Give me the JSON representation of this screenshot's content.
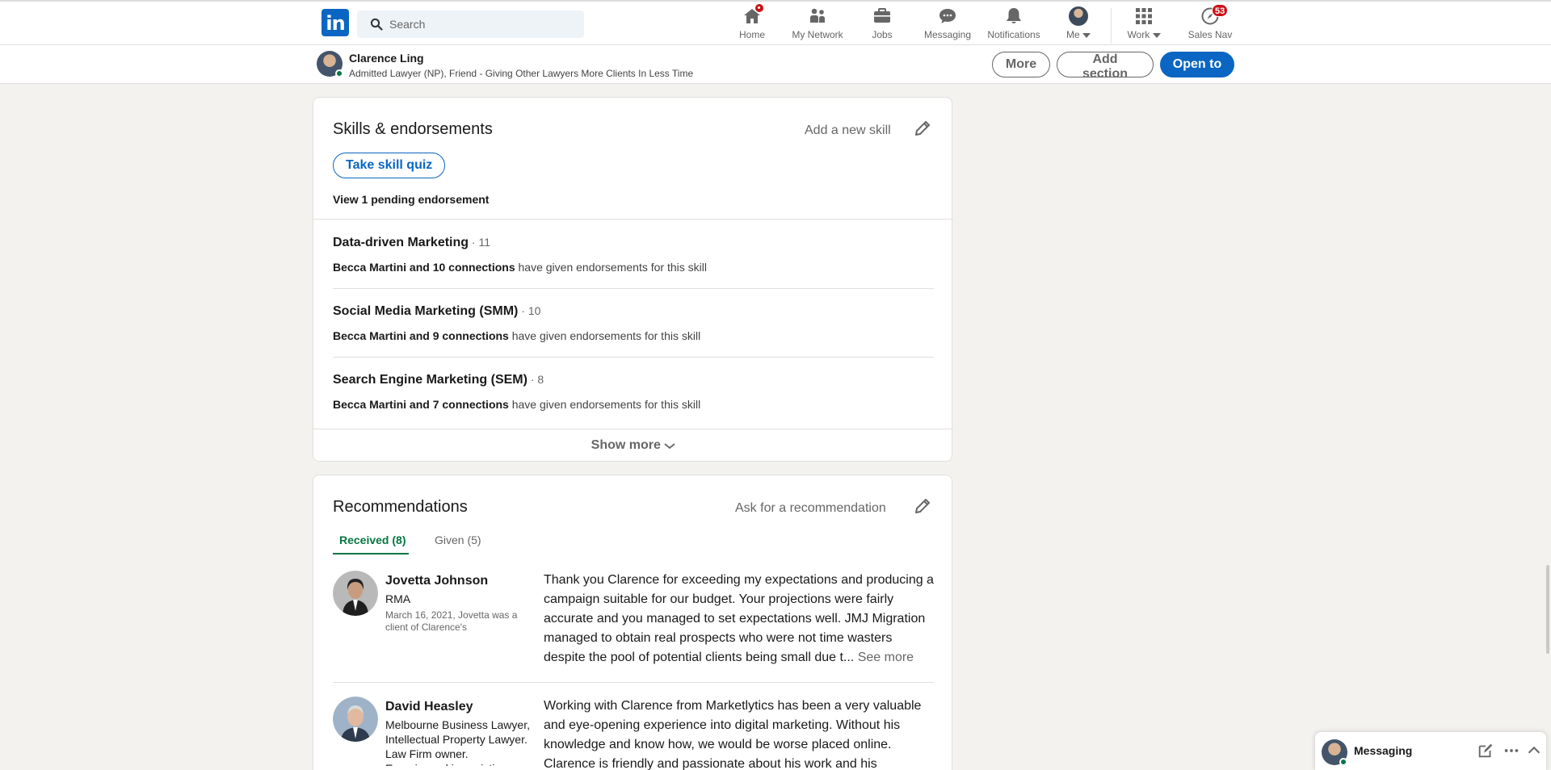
{
  "nav": {
    "logo": "in",
    "search_placeholder": "Search",
    "items": [
      {
        "label": "Home",
        "icon": "home-icon",
        "badge": ""
      },
      {
        "label": "My Network",
        "icon": "people-icon",
        "badge": ""
      },
      {
        "label": "Jobs",
        "icon": "briefcase-icon",
        "badge": ""
      },
      {
        "label": "Messaging",
        "icon": "chat-icon",
        "badge": ""
      },
      {
        "label": "Notifications",
        "icon": "bell-icon",
        "badge": ""
      },
      {
        "label": "Me",
        "icon": "avatar",
        "badge": ""
      },
      {
        "label": "Work",
        "icon": "grid-icon",
        "badge": ""
      },
      {
        "label": "Sales Nav",
        "icon": "compass-icon",
        "badge": "53"
      }
    ]
  },
  "profile_bar": {
    "name": "Clarence Ling",
    "headline": "Admitted Lawyer (NP), Friend - Giving Other Lawyers More Clients In Less Time",
    "more_label": "More",
    "add_section_label": "Add section",
    "open_to_label": "Open to"
  },
  "skills": {
    "title": "Skills & endorsements",
    "add_label": "Add a new skill",
    "quiz_label": "Take skill quiz",
    "pending_label": "View 1 pending endorsement",
    "items": [
      {
        "name": "Data-driven Marketing",
        "count": " · 11",
        "endorsers": "Becca Martini and 10 connections",
        "suffix": " have given endorsements for this skill"
      },
      {
        "name": "Social Media Marketing (SMM)",
        "count": " · 10",
        "endorsers": "Becca Martini and 9 connections",
        "suffix": " have given endorsements for this skill"
      },
      {
        "name": "Search Engine Marketing (SEM)",
        "count": " · 8",
        "endorsers": "Becca Martini and 7 connections",
        "suffix": " have given endorsements for this skill"
      }
    ],
    "show_more_label": "Show more"
  },
  "recommendations": {
    "title": "Recommendations",
    "ask_label": "Ask for a recommendation",
    "tab_received": "Received (8)",
    "tab_given": "Given (5)",
    "items": [
      {
        "name": "Jovetta Johnson",
        "title": "RMA",
        "meta": "March 16, 2021, Jovetta was a client of Clarence's",
        "text": "Thank you Clarence for exceeding my expectations and producing a campaign suitable for our budget. Your projections were fairly accurate and you managed to set expectations well. JMJ Migration managed to obtain real prospects who were not time wasters despite the pool of potential clients being small due t...",
        "see_more": "See more"
      },
      {
        "name": "David Heasley",
        "title": "Melbourne Business Lawyer, Intellectual Property Lawyer. Law Firm owner. Experienced in assisting",
        "meta": "",
        "text": "Working with Clarence from Marketlytics has been a very valuable and eye-opening experience into digital marketing. Without his knowledge and know how, we would be worse placed online. Clarence is friendly and passionate about his work and his",
        "see_more": ""
      }
    ]
  },
  "messaging": {
    "label": "Messaging"
  },
  "colors": {
    "brand": "#0a66c2",
    "green": "#057642",
    "badge": "#cc1016",
    "background": "#f3f2ef"
  }
}
